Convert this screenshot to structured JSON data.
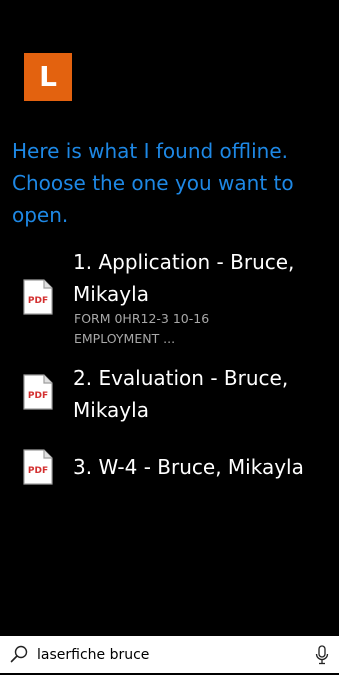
{
  "app": {
    "logo_letter": "L",
    "logo_color": "#e3620f",
    "logo_icon": "laserfiche-logo"
  },
  "message": "Here is what I found offline. Choose the one you want to open.",
  "results": [
    {
      "title": "1. Application - Bruce, Mikayla",
      "subtitle": "FORM 0HR12-3 10-16\nEMPLOYMENT ...",
      "icon": "pdf-icon",
      "icon_label": "PDF"
    },
    {
      "title": "2. Evaluation - Bruce, Mikayla",
      "icon": "pdf-icon",
      "icon_label": "PDF"
    },
    {
      "title": "3. W-4 - Bruce, Mikayla",
      "icon": "pdf-icon",
      "icon_label": "PDF"
    }
  ],
  "search": {
    "query": "laserfiche bruce",
    "search_icon": "search-icon",
    "mic_icon": "microphone-icon"
  },
  "colors": {
    "background": "#000000",
    "accent": "#1e88e5",
    "pdf_red": "#d32f2f"
  }
}
